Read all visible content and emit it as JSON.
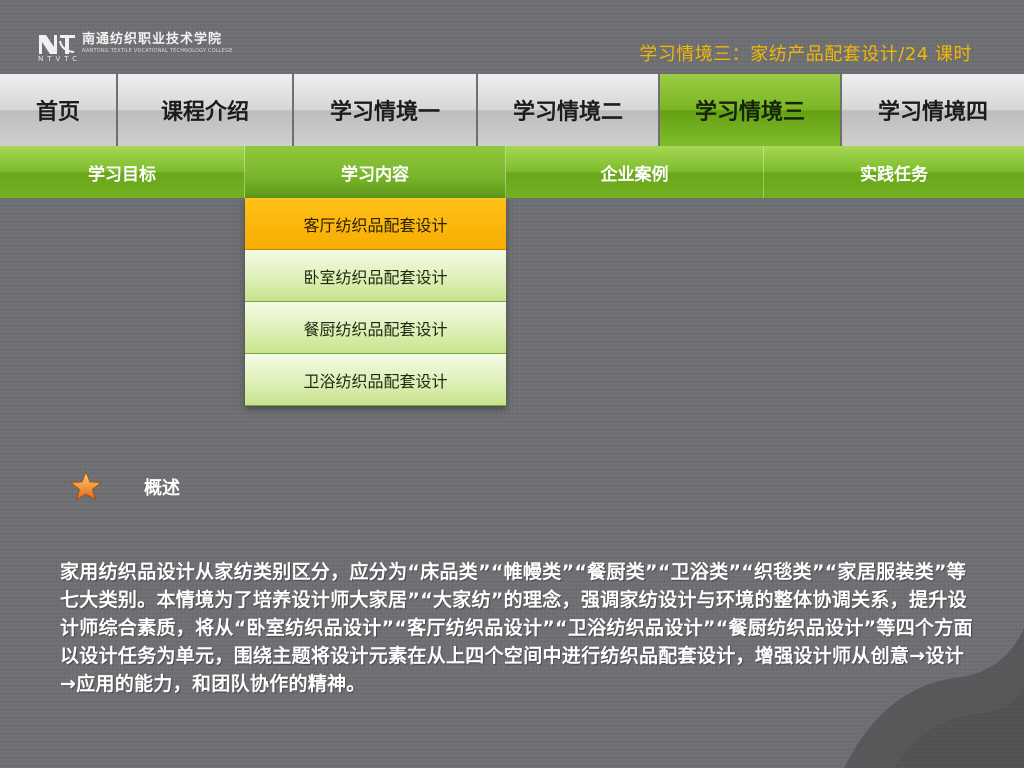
{
  "header": {
    "logo_cn": "南通纺织职业技术学院",
    "logo_en": "NANTONG TEXTILE VOCATIONAL TECHNOLOGY COLLEGE",
    "logo_abbr": "NTVTC",
    "unit_title": "学习情境三：家纺产品配套设计/24 课时"
  },
  "topnav": {
    "items": [
      {
        "label": "首页"
      },
      {
        "label": "课程介绍"
      },
      {
        "label": "学习情境一"
      },
      {
        "label": "学习情境二"
      },
      {
        "label": "学习情境三",
        "active": true
      },
      {
        "label": "学习情境四"
      }
    ]
  },
  "subnav": {
    "items": [
      {
        "label": "学习目标"
      },
      {
        "label": "学习内容",
        "active": true
      },
      {
        "label": "企业案例"
      },
      {
        "label": "实践任务"
      }
    ]
  },
  "dropdown": {
    "items": [
      {
        "label": "客厅纺织品配套设计",
        "active": true
      },
      {
        "label": "卧室纺织品配套设计"
      },
      {
        "label": "餐厨纺织品配套设计"
      },
      {
        "label": "卫浴纺织品配套设计"
      }
    ]
  },
  "overview": {
    "label": "概述",
    "icon": "star-icon",
    "text": "家用纺织品设计从家纺类别区分，应分为“床品类”“帷幔类”“餐厨类”“卫浴类”“织毯类”“家居服装类”等七大类别。本情境为了培养设计师大家居”“大家纺”的理念，强调家纺设计与环境的整体协调关系，提升设计师综合素质，将从“卧室纺织品设计”“客厅纺织品设计”“卫浴纺织品设计”“餐厨纺织品设计”等四个方面以设计任务为单元，围绕主题将设计元素在从上四个空间中进行纺织品配套设计，增强设计师从创意→设计→应用的能力，和团队协作的精神。"
  },
  "colors": {
    "accent_green": "#7cb525",
    "accent_orange": "#f7ad00",
    "title_yellow": "#f2b705",
    "background": "#6e6f72"
  }
}
